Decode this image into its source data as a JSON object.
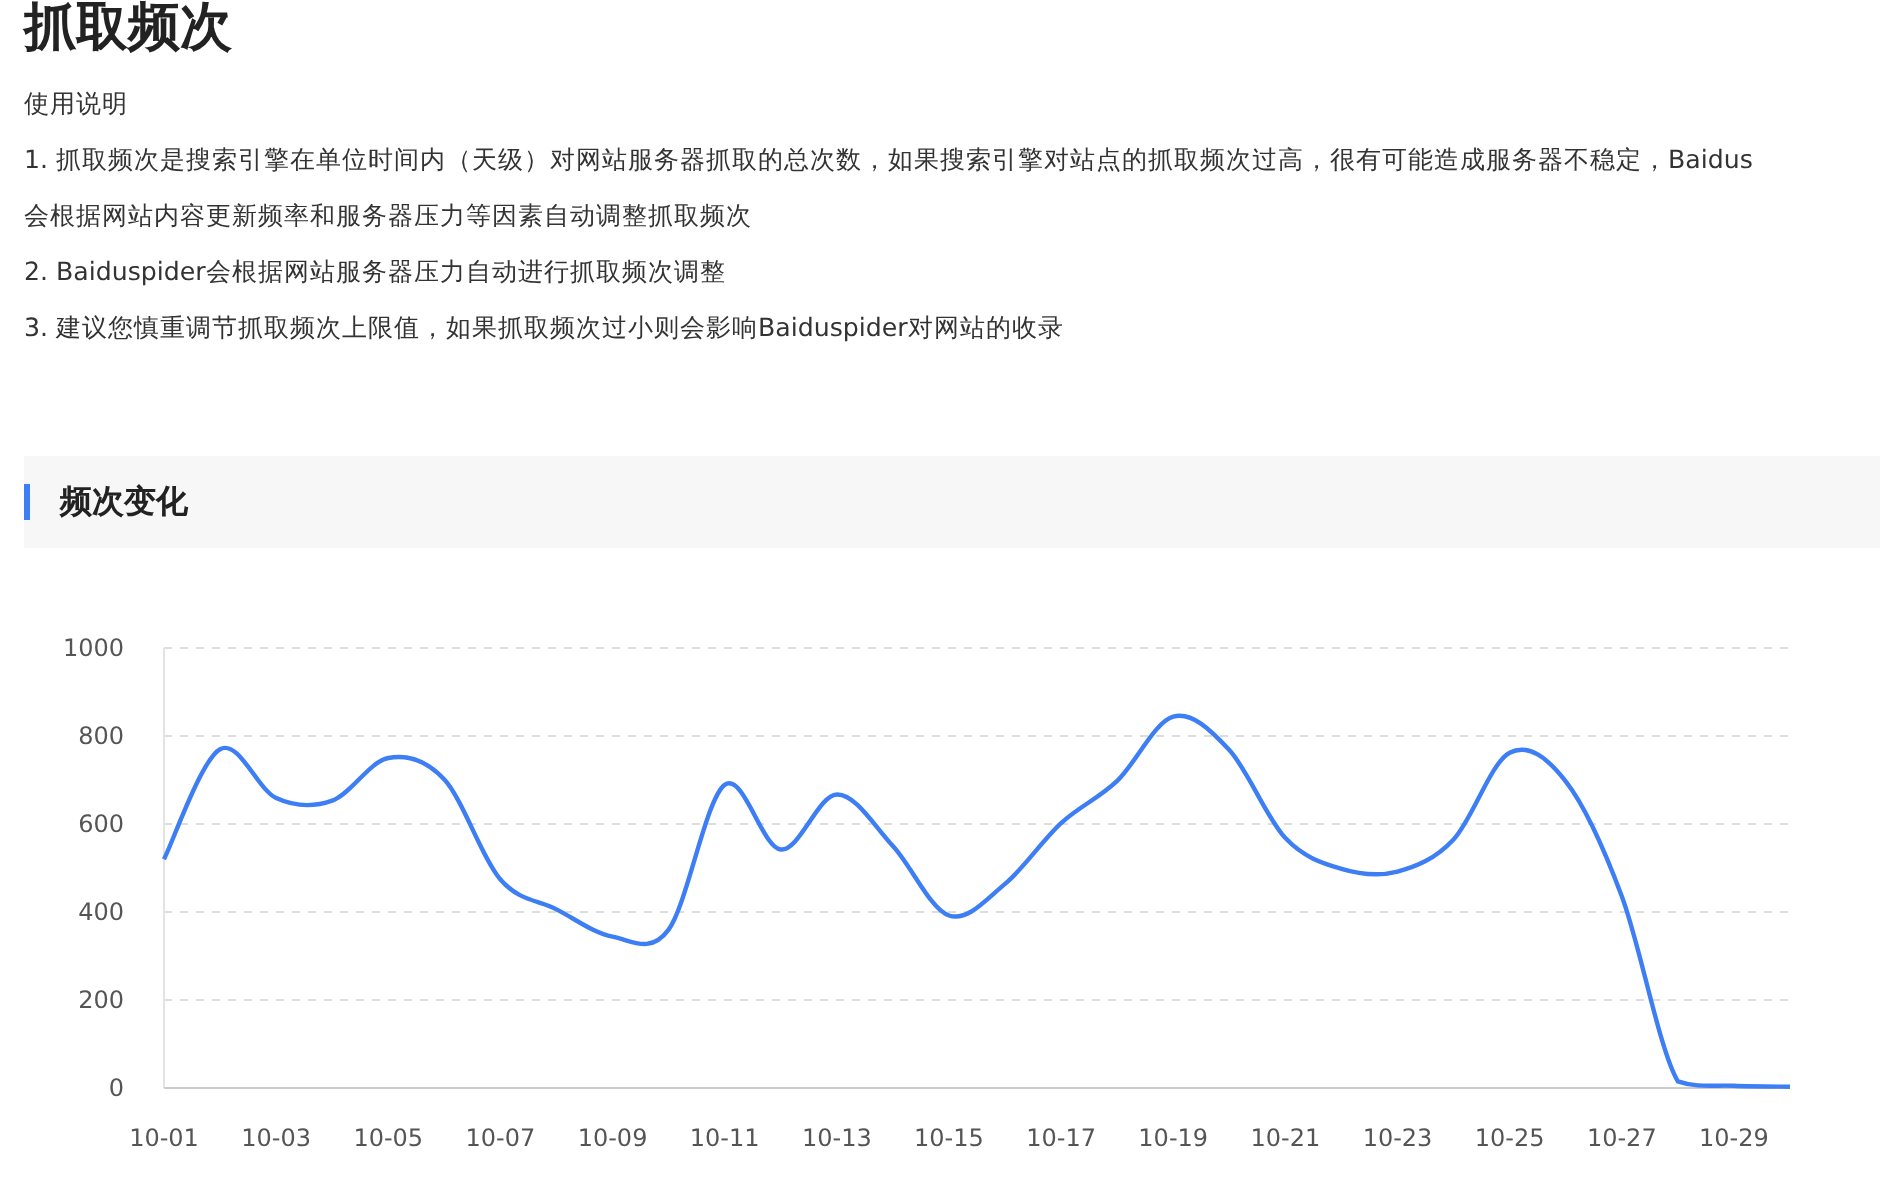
{
  "page_title": "抓取频次",
  "instructions": {
    "heading": "使用说明",
    "lines": [
      "1. 抓取频次是搜索引擎在单位时间内（天级）对网站服务器抓取的总次数，如果搜索引擎对站点的抓取频次过高，很有可能造成服务器不稳定，Baidus",
      "会根据网站内容更新频率和服务器压力等因素自动调整抓取频次",
      "2. Baiduspider会根据网站服务器压力自动进行抓取频次调整",
      "3. 建议您慎重调节抓取频次上限值，如果抓取频次过小则会影响Baiduspider对网站的收录"
    ]
  },
  "section": {
    "title": "频次变化",
    "chart_data": {
      "type": "line",
      "categories": [
        "10-01",
        null,
        "10-03",
        null,
        "10-05",
        null,
        "10-07",
        null,
        "10-09",
        null,
        "10-11",
        null,
        "10-13",
        null,
        "10-15",
        null,
        "10-17",
        null,
        "10-19",
        null,
        "10-21",
        null,
        "10-23",
        null,
        "10-25",
        null,
        "10-27",
        null,
        "10-29",
        null
      ],
      "series": [
        {
          "color": "#3d7ef5",
          "values": [
            520,
            770,
            659,
            653,
            750,
            701,
            474,
            406,
            344,
            360,
            689,
            542,
            667,
            550,
            392,
            464,
            602,
            698,
            844,
            768,
            568,
            498,
            492,
            565,
            762,
            697,
            436,
            15,
            5,
            3
          ]
        }
      ],
      "grid": true,
      "ylim": [
        0,
        1000
      ],
      "yticks": [
        0,
        200,
        400,
        600,
        800,
        1000
      ]
    }
  }
}
